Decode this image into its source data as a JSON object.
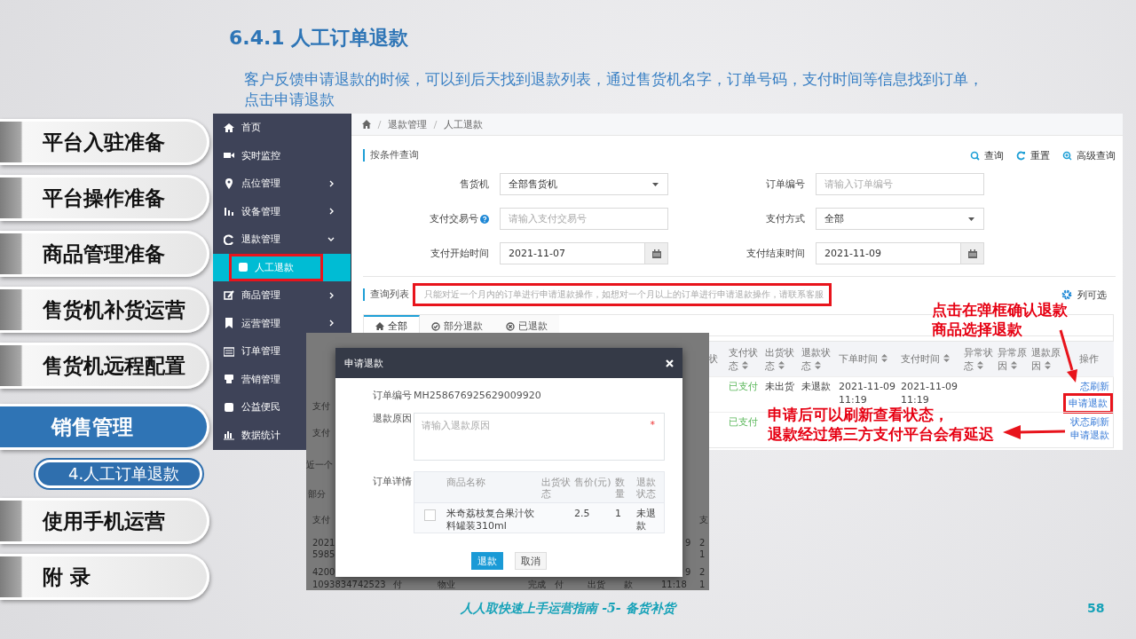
{
  "slide": {
    "title": "6.4.1 人工订单退款",
    "intro": "客户反馈申请退款的时候，可以到后天找到退款列表，通过售货机名字，订单号码，支付时间等信息找到订单，点击申请退款",
    "footer": "人人取快速上手运营指南 -5- 备货补货",
    "page_number": "58"
  },
  "chapters": [
    {
      "label": "平台入驻准备",
      "kind": "chapter",
      "selected": false
    },
    {
      "label": "平台操作准备",
      "kind": "chapter",
      "selected": false
    },
    {
      "label": "商品管理准备",
      "kind": "chapter",
      "selected": false
    },
    {
      "label": "售货机补货运营",
      "kind": "chapter",
      "selected": false
    },
    {
      "label": "售货机远程配置",
      "kind": "chapter",
      "selected": false
    },
    {
      "label": "销售管理",
      "kind": "chapter",
      "selected": true
    },
    {
      "label": "4.人工订单退款",
      "kind": "section",
      "selected": true
    },
    {
      "label": "使用手机运营",
      "kind": "chapter",
      "selected": false
    },
    {
      "label": "附 录",
      "kind": "chapter",
      "selected": false
    }
  ],
  "sidebar": {
    "items": [
      {
        "label": "首页",
        "kind": "link",
        "selected": false
      },
      {
        "label": "实时监控",
        "kind": "link",
        "selected": false
      },
      {
        "label": "点位管理",
        "kind": "group",
        "selected": false,
        "expanded": false
      },
      {
        "label": "设备管理",
        "kind": "group",
        "selected": false,
        "expanded": false
      },
      {
        "label": "退款管理",
        "kind": "group",
        "selected": false,
        "expanded": true,
        "children": [
          {
            "label": "人工退款",
            "selected": true,
            "highlighted": true
          }
        ]
      },
      {
        "label": "商品管理",
        "kind": "group",
        "selected": false,
        "expanded": false
      },
      {
        "label": "运营管理",
        "kind": "group",
        "selected": false,
        "expanded": false
      },
      {
        "label": "订单管理",
        "kind": "link",
        "selected": false
      },
      {
        "label": "营销管理",
        "kind": "link",
        "selected": false
      },
      {
        "label": "公益便民",
        "kind": "link",
        "selected": false
      },
      {
        "label": "数据统计",
        "kind": "link",
        "selected": false
      }
    ]
  },
  "breadcrumb": [
    "退款管理",
    "人工退款"
  ],
  "filter": {
    "title": "按条件查询",
    "actions": [
      "查询",
      "重置",
      "高级查询"
    ],
    "fields": [
      {
        "label": "售货机",
        "kind": "select",
        "value": "全部售货机",
        "help": false
      },
      {
        "label": "订单编号",
        "kind": "text",
        "placeholder": "请输入订单编号",
        "help": false
      },
      {
        "label": "支付交易号",
        "kind": "text",
        "placeholder": "请输入支付交易号",
        "help": true
      },
      {
        "label": "支付方式",
        "kind": "select",
        "value": "全部",
        "help": false
      },
      {
        "label": "支付开始时间",
        "kind": "date",
        "value": "2021-11-07",
        "help": false
      },
      {
        "label": "支付结束时间",
        "kind": "date",
        "value": "2021-11-09",
        "help": false
      }
    ]
  },
  "list": {
    "title": "查询列表",
    "hint": "只能对近一个月内的订单进行申请退款操作，如想对一个月以上的订单进行申请退款操作，请联系客服",
    "hint_highlighted": true,
    "column_picker": "列可选",
    "tabs": [
      {
        "label": "全部",
        "selected": true
      },
      {
        "label": "部分退款",
        "selected": false
      },
      {
        "label": "已退款",
        "selected": false
      }
    ],
    "table": {
      "columns": [
        {
          "label": "状",
          "sortable": false
        },
        {
          "label": "支付状态",
          "sortable": true
        },
        {
          "label": "出货状态",
          "sortable": true
        },
        {
          "label": "退款状态",
          "sortable": true
        },
        {
          "label": "下单时间",
          "sortable": true
        },
        {
          "label": "支付时间",
          "sortable": true
        },
        {
          "label": "异常状态",
          "sortable": true
        },
        {
          "label": "异常原因",
          "sortable": true
        },
        {
          "label": "退款原因",
          "sortable": true
        },
        {
          "label": "操作",
          "sortable": false
        }
      ],
      "rows": [
        {
          "pay_status": "已支付",
          "ship_status": "未出货",
          "refund_status": "未退款",
          "order_time": "2021-11-09 11:19",
          "pay_time": "2021-11-09 11:19",
          "actions": [
            "态刷新",
            "申请退款"
          ],
          "highlighted": true
        },
        {
          "pay_status": "已支付",
          "actions": [
            "状态刷新",
            "申请退款"
          ],
          "highlighted": false
        }
      ]
    }
  },
  "backdrop_texts": [
    "支付",
    "支付",
    "近一个",
    "部分",
    "支付",
    "2021",
    "5985",
    "4200",
    "1093834742523",
    "付",
    "物业",
    "完成",
    "付",
    "出货",
    "款",
    "11:18",
    "支",
    "9",
    "2",
    "1",
    "9",
    "2",
    "1"
  ],
  "modal": {
    "title": "申请退款",
    "order_label": "订单编号",
    "order_no": "MH258676925629009920",
    "reason_label": "退款原因",
    "reason_placeholder": "请输入退款原因",
    "required_mark": "*",
    "detail_label": "订单详情",
    "columns": [
      "商品名称",
      "出货状态",
      "售价(元)",
      "数量",
      "退款状态"
    ],
    "items": [
      {
        "checked": false,
        "name": "米奇荔枝复合果汁饮料罐装310ml",
        "price": "2.5",
        "qty": "1",
        "refund_status": "未退款"
      }
    ],
    "buttons": [
      {
        "label": "退款",
        "kind": "primary"
      },
      {
        "label": "取消",
        "kind": "default"
      }
    ]
  },
  "callouts": [
    {
      "lines": [
        "点击在弹框确认退款",
        "商品选择退款"
      ]
    },
    {
      "lines": [
        "申请后可以刷新查看状态，",
        "退款经过第三方支付平台会有延迟"
      ]
    }
  ]
}
